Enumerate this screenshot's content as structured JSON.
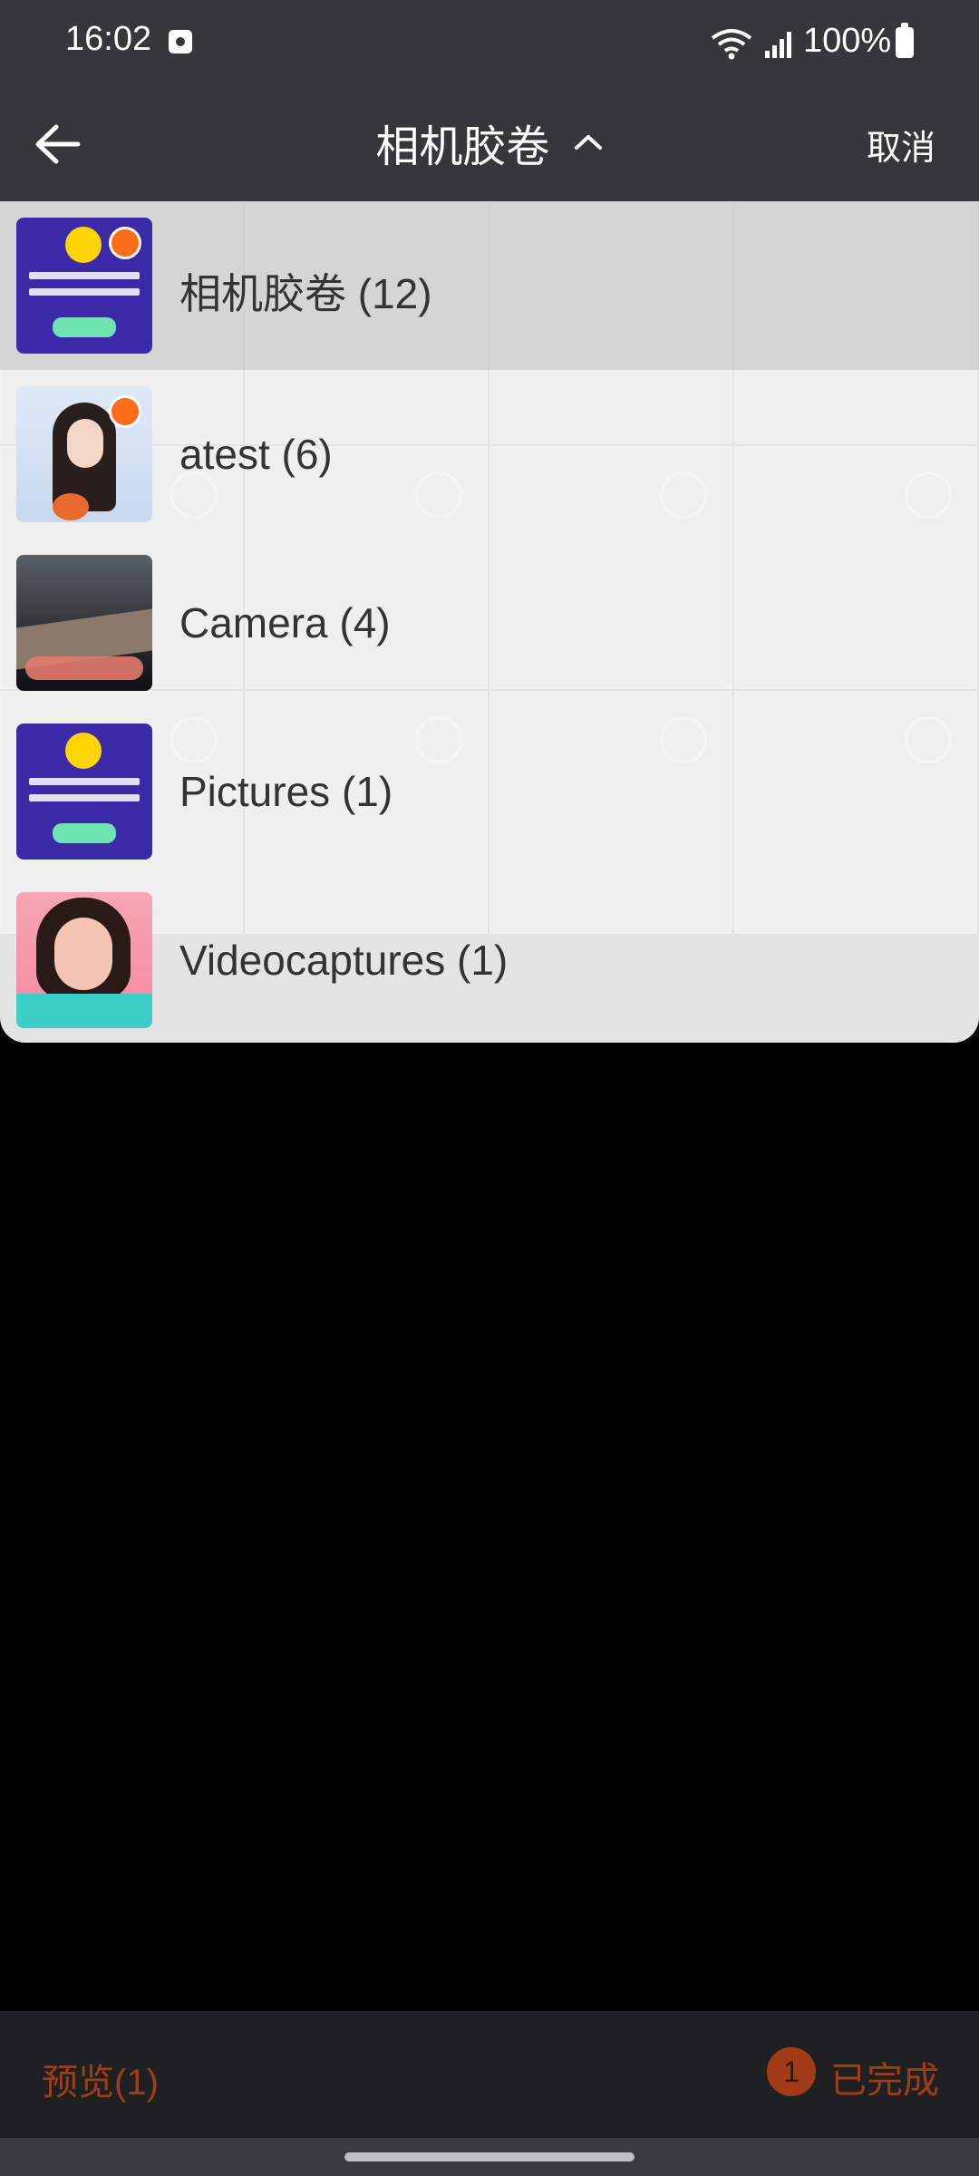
{
  "status_bar": {
    "time": "16:02",
    "battery": "100%"
  },
  "header": {
    "title": "相机胶卷",
    "cancel": "取消"
  },
  "albums": [
    {
      "label": "相机胶卷 (12)",
      "selected": true
    },
    {
      "label": "atest (6)",
      "selected": false
    },
    {
      "label": "Camera (4)",
      "selected": false
    },
    {
      "label": "Pictures (1)",
      "selected": false
    },
    {
      "label": "Videocaptures (1)",
      "selected": false
    }
  ],
  "footer": {
    "preview": "预览(1)",
    "count": "1",
    "done": "已完成"
  },
  "colors": {
    "accent": "#ff6d1a",
    "bar": "#363739",
    "footer_text": "#a13b18"
  }
}
